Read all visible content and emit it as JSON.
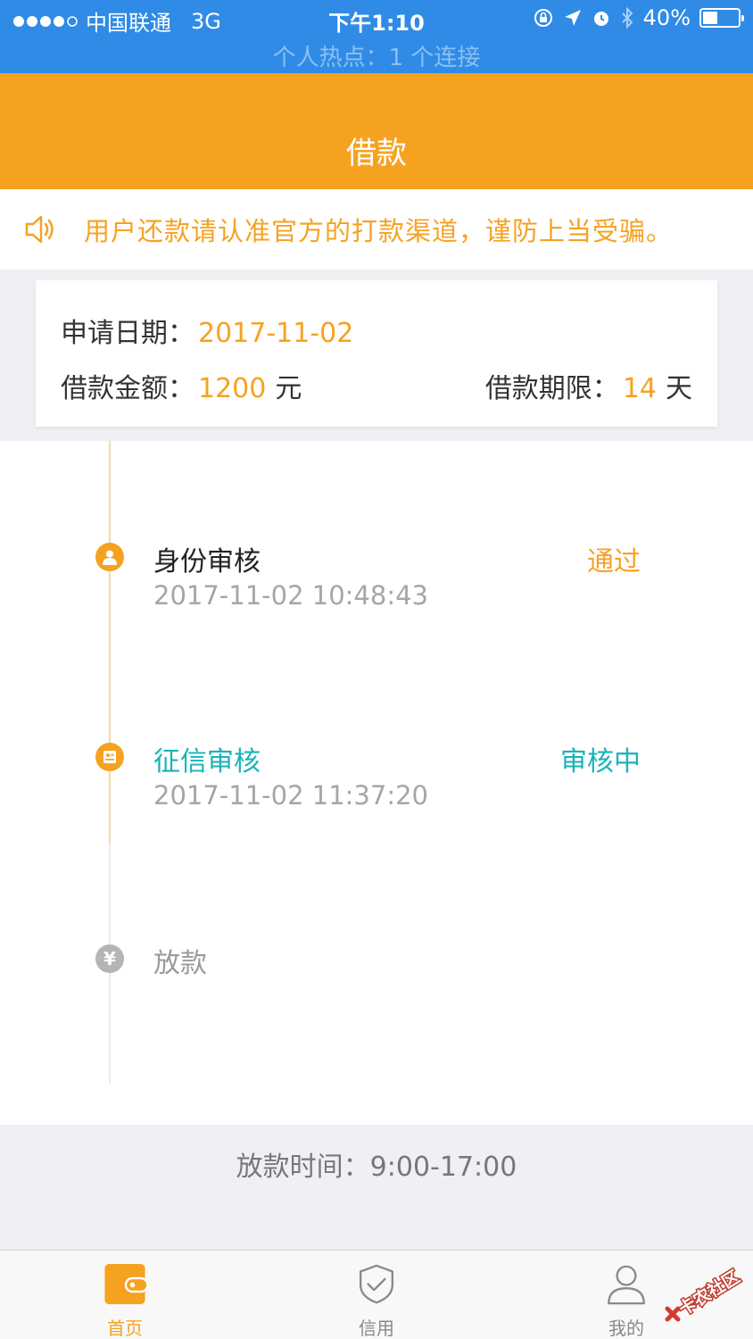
{
  "status_bar": {
    "carrier": "中国联通",
    "network": "3G",
    "time": "下午1:10",
    "battery": "40%",
    "hotspot": "个人热点：1 个连接"
  },
  "nav": {
    "title": "借款"
  },
  "notice": {
    "text": "用户还款请认准官方的打款渠道，谨防上当受骗。"
  },
  "loan_info": {
    "apply_date_label": "申请日期：",
    "apply_date": "2017-11-02",
    "amount_label": "借款金额：",
    "amount": "1200",
    "amount_unit": "元",
    "term_label": "借款期限：",
    "term": "14",
    "term_unit": "天"
  },
  "steps": [
    {
      "title": "身份审核",
      "status": "通过",
      "time": "2017-11-02 10:48:43",
      "state": "done",
      "title_color": "#222222",
      "status_color": "#f6a221"
    },
    {
      "title": "征信审核",
      "status": "审核中",
      "time": "2017-11-02 11:37:20",
      "state": "current",
      "title_color": "#1ab3b8",
      "status_color": "#1ab3b8"
    },
    {
      "title": "放款",
      "symbol": "¥",
      "state": "pending",
      "title_color": "#9a9a9a"
    }
  ],
  "footer": {
    "loan_time": "放款时间：9:00-17:00"
  },
  "tabs": [
    {
      "label": "首页",
      "icon": "wallet-icon",
      "active": true
    },
    {
      "label": "信用",
      "icon": "shield-check-icon",
      "active": false
    },
    {
      "label": "我的",
      "icon": "user-icon",
      "active": false
    }
  ],
  "watermark": {
    "text": "卡农社区"
  },
  "colors": {
    "accent": "#f6a221",
    "status_bar": "#2f8be6",
    "teal": "#1ab3b8"
  }
}
